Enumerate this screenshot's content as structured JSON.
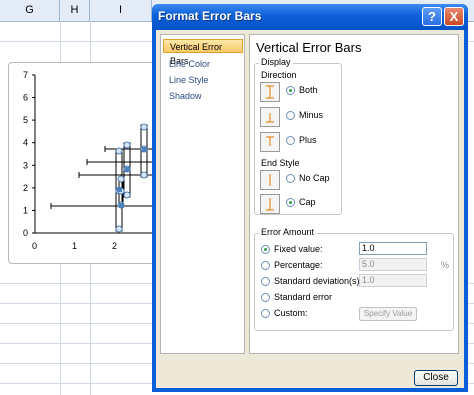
{
  "spreadsheet": {
    "columns": [
      "G",
      "H",
      "I"
    ],
    "chart": {
      "y_tick_labels": [
        "7",
        "6",
        "5",
        "4",
        "3",
        "2",
        "1",
        "0"
      ],
      "x_tick_labels": [
        "0",
        "1",
        "2"
      ]
    }
  },
  "dialog": {
    "title": "Format Error Bars",
    "help_glyph": "?",
    "close_glyph": "X",
    "nav_items": [
      "Vertical Error Bars",
      "Line Color",
      "Line Style",
      "Shadow"
    ],
    "selected_nav": "Vertical Error Bars",
    "panel_title": "Vertical Error Bars",
    "display": {
      "group_label": "Display",
      "direction_label": "Direction",
      "direction_options": [
        "Both",
        "Minus",
        "Plus"
      ],
      "direction_selected": "Both",
      "end_style_label": "End Style",
      "end_style_options": [
        "No Cap",
        "Cap"
      ],
      "end_style_selected": "Cap"
    },
    "error_amount": {
      "group_label": "Error Amount",
      "options": [
        "Fixed value:",
        "Percentage:",
        "Standard deviation(s):",
        "Standard error",
        "Custom:"
      ],
      "selected": "Fixed value:",
      "fixed_value": "1.0",
      "percentage_value": "5.0",
      "percent_sign": "%",
      "std_dev_value": "1.0",
      "specify_value_label": "Specify Value"
    },
    "close_label": "Close"
  },
  "colors": {
    "title_bar": "#0b5fd7",
    "dialog_face": "#ece9d8",
    "selected_nav": "#f8c86a",
    "radio_checked": "#2ea24b"
  }
}
